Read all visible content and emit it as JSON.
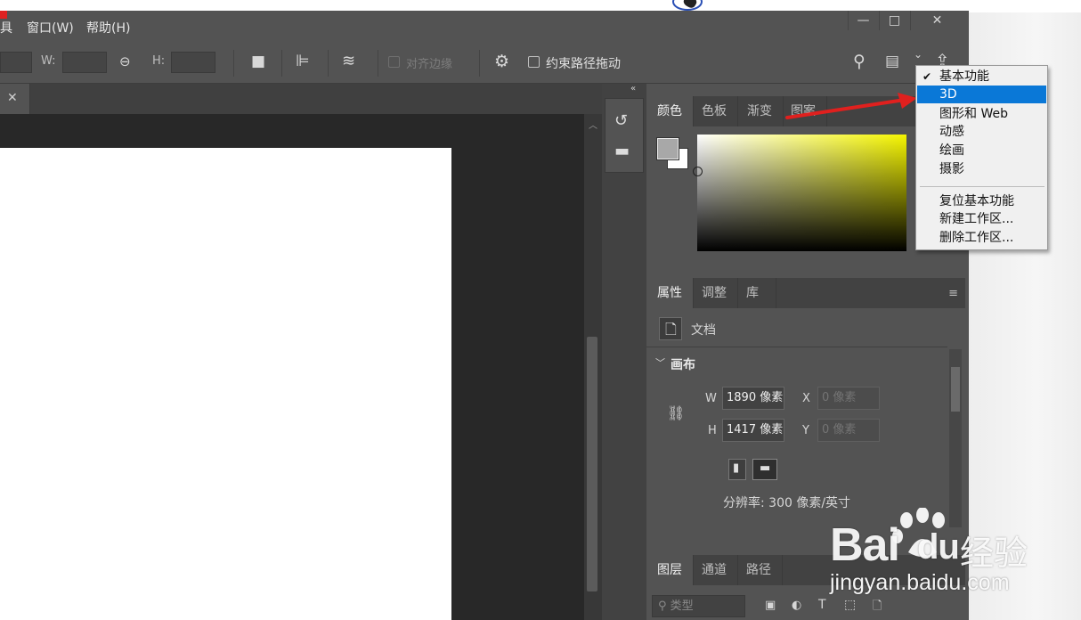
{
  "menubar": {
    "items": [
      "具",
      "窗口(W)",
      "帮助(H)"
    ],
    "window_buttons": [
      "—",
      "□",
      "✕"
    ]
  },
  "options_bar": {
    "w_label": "W:",
    "h_label": "H:",
    "align_edges_label": "对齐边缘",
    "constrain_path_label": "约束路径拖动"
  },
  "document_tab": {
    "close": "✕"
  },
  "color_panel": {
    "tabs": [
      "颜色",
      "色板",
      "渐变",
      "图案"
    ],
    "foreground_color": "#a8a8a8",
    "background_color": "#ffffff"
  },
  "properties_panel": {
    "tabs": [
      "属性",
      "调整",
      "库"
    ],
    "doc_label": "文档",
    "canvas_section": "画布",
    "width_label": "W",
    "width_value": "1890 像素",
    "height_label": "H",
    "height_value": "1417 像素",
    "x_label": "X",
    "x_value": "0 像素",
    "y_label": "Y",
    "y_value": "0 像素",
    "resolution": "分辨率: 300 像素/英寸"
  },
  "layers_panel": {
    "tabs": [
      "图层",
      "通道",
      "路径"
    ],
    "search_placeholder": "类型"
  },
  "workspace_menu": {
    "items": [
      {
        "label": "基本功能",
        "checked": true
      },
      {
        "label": "3D",
        "highlighted": true
      },
      {
        "label": "图形和 Web"
      },
      {
        "label": "动感"
      },
      {
        "label": "绘画"
      },
      {
        "label": "摄影"
      }
    ],
    "actions": [
      "复位基本功能",
      "新建工作区...",
      "删除工作区..."
    ]
  },
  "watermark": {
    "brand": "Bai",
    "brand_suffix": "du",
    "product": "经验",
    "url": "jingyan.baidu.com"
  }
}
